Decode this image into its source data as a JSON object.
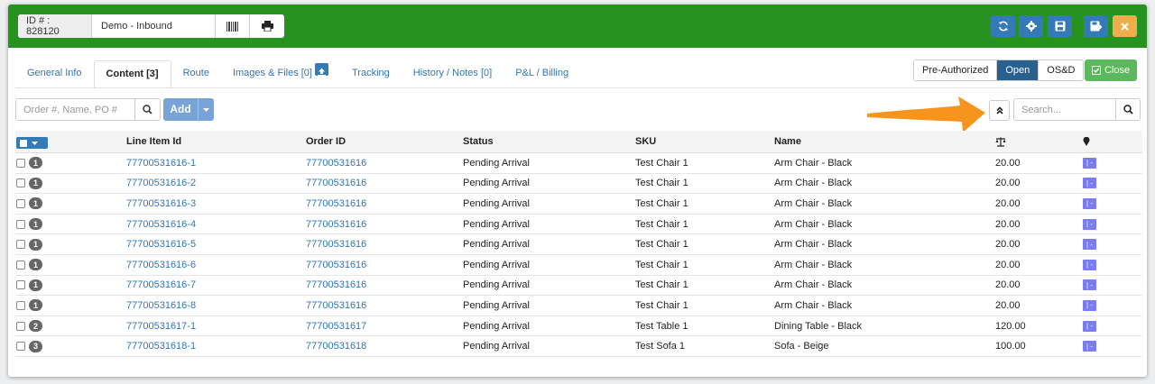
{
  "header": {
    "id_label": "ID # : 828120",
    "name": "Demo - Inbound",
    "icons": {
      "barcode": "barcode-icon",
      "print": "print-icon",
      "refresh": "refresh-icon",
      "settings": "gear-icon",
      "save": "save-icon",
      "save_close": "save-close-icon",
      "close": "close-icon"
    },
    "colors": {
      "bar": "#27921f",
      "primary": "#337ab7",
      "warning": "#f0ad4e"
    }
  },
  "tabs": [
    {
      "label": "General Info",
      "active": false
    },
    {
      "label": "Content [3]",
      "active": true
    },
    {
      "label": "Route",
      "active": false
    },
    {
      "label": "Images & Files [0]",
      "active": false
    },
    {
      "label": "Tracking",
      "active": false
    },
    {
      "label": "History / Notes [0]",
      "active": false
    },
    {
      "label": "P&L / Billing",
      "active": false
    }
  ],
  "status_buttons": [
    {
      "label": "Pre-Authorized",
      "active": false
    },
    {
      "label": "Open",
      "active": true
    },
    {
      "label": "OS&D",
      "active": false
    }
  ],
  "close_label": "Close",
  "toolbar": {
    "search_placeholder": "Order #, Name, PO #",
    "add_label": "Add",
    "right_search_placeholder": "Search..."
  },
  "table": {
    "columns": [
      "Line Item Id",
      "Order ID",
      "Status",
      "SKU",
      "Name"
    ],
    "weight_icon": "scale-icon",
    "location_icon": "map-marker-icon",
    "tag_text": "| -",
    "rows": [
      {
        "qty": "1",
        "line_item_id": "77700531616-1",
        "order_id": "77700531616",
        "status": "Pending Arrival",
        "sku": "Test Chair 1",
        "name": "Arm Chair - Black",
        "weight": "20.00"
      },
      {
        "qty": "1",
        "line_item_id": "77700531616-2",
        "order_id": "77700531616",
        "status": "Pending Arrival",
        "sku": "Test Chair 1",
        "name": "Arm Chair - Black",
        "weight": "20.00"
      },
      {
        "qty": "1",
        "line_item_id": "77700531616-3",
        "order_id": "77700531616",
        "status": "Pending Arrival",
        "sku": "Test Chair 1",
        "name": "Arm Chair - Black",
        "weight": "20.00"
      },
      {
        "qty": "1",
        "line_item_id": "77700531616-4",
        "order_id": "77700531616",
        "status": "Pending Arrival",
        "sku": "Test Chair 1",
        "name": "Arm Chair - Black",
        "weight": "20.00"
      },
      {
        "qty": "1",
        "line_item_id": "77700531616-5",
        "order_id": "77700531616",
        "status": "Pending Arrival",
        "sku": "Test Chair 1",
        "name": "Arm Chair - Black",
        "weight": "20.00"
      },
      {
        "qty": "1",
        "line_item_id": "77700531616-6",
        "order_id": "77700531616",
        "status": "Pending Arrival",
        "sku": "Test Chair 1",
        "name": "Arm Chair - Black",
        "weight": "20.00"
      },
      {
        "qty": "1",
        "line_item_id": "77700531616-7",
        "order_id": "77700531616",
        "status": "Pending Arrival",
        "sku": "Test Chair 1",
        "name": "Arm Chair - Black",
        "weight": "20.00"
      },
      {
        "qty": "1",
        "line_item_id": "77700531616-8",
        "order_id": "77700531616",
        "status": "Pending Arrival",
        "sku": "Test Chair 1",
        "name": "Arm Chair - Black",
        "weight": "20.00"
      },
      {
        "qty": "2",
        "line_item_id": "77700531617-1",
        "order_id": "77700531617",
        "status": "Pending Arrival",
        "sku": "Test Table 1",
        "name": "Dining Table - Black",
        "weight": "120.00"
      },
      {
        "qty": "3",
        "line_item_id": "77700531618-1",
        "order_id": "77700531618",
        "status": "Pending Arrival",
        "sku": "Test Sofa 1",
        "name": "Sofa - Beige",
        "weight": "100.00"
      }
    ]
  }
}
